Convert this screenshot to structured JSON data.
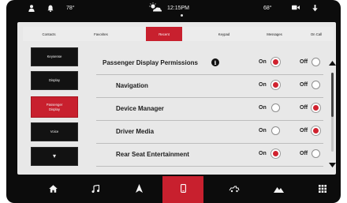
{
  "status": {
    "temp_left": "78°",
    "time": "12:15PM",
    "temp_right": "68°"
  },
  "tabs": [
    "Contacts",
    "Favorites",
    "Recent",
    "Keypad",
    "Messages",
    "On Call"
  ],
  "active_tab": "Recent",
  "side_menu": {
    "keysense": "Keysense",
    "display": "Display",
    "passenger_display_line1": "Passenger",
    "passenger_display_line2": "Display",
    "voice": "Voice",
    "more": "▾"
  },
  "settings": [
    {
      "label": "Passenger Display Permissions",
      "value": "On",
      "has_info": true
    },
    {
      "label": "Navigation",
      "value": "On"
    },
    {
      "label": "Device Manager",
      "value": "Off"
    },
    {
      "label": "Driver Media",
      "value": "Off"
    },
    {
      "label": "Rear Seat Entertainment",
      "value": "On"
    }
  ],
  "option_labels": {
    "on": "On",
    "off": "Off"
  },
  "bottom_nav": [
    "home-icon",
    "music-icon",
    "navigation-icon",
    "phone-icon",
    "vehicle-icon",
    "apps-icon",
    "grid-icon"
  ],
  "active_nav": "phone-icon",
  "colors": {
    "accent": "#c8202e",
    "background": "#0c0c0c",
    "panel": "#e8e8e8"
  }
}
